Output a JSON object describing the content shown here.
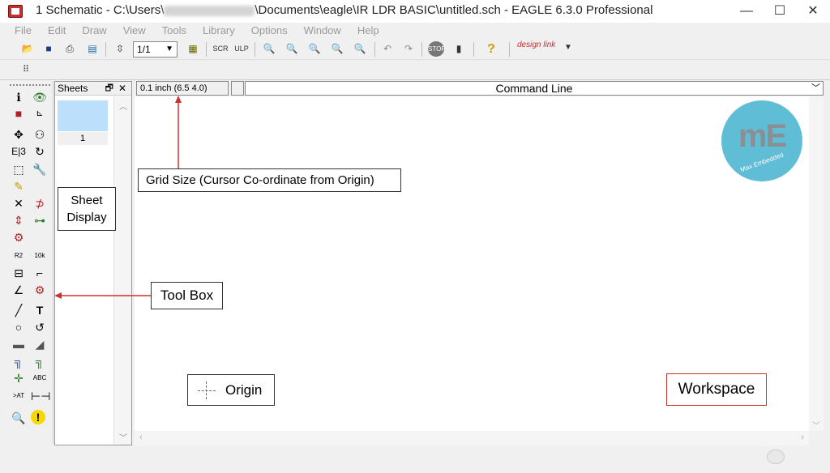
{
  "window": {
    "title_prefix": "1 Schematic - C:\\Users\\",
    "title_suffix": "\\Documents\\eagle\\IR LDR BASIC\\untitled.sch - EAGLE 6.3.0 Professional",
    "minimize": "—",
    "maximize": "☐",
    "close": "✕"
  },
  "menu": [
    "File",
    "Edit",
    "Draw",
    "View",
    "Tools",
    "Library",
    "Options",
    "Window",
    "Help"
  ],
  "toolbar": {
    "zoom_value": "1/1",
    "designlink_label": "design link"
  },
  "sheets_panel": {
    "title": "Sheets",
    "pin": "🗗",
    "close": "✕",
    "sheet_number": "1"
  },
  "coordinate_display": "0.1 inch (6.5 4.0)",
  "command_line": {
    "label": "Command Line"
  },
  "logo": {
    "text": "mE",
    "sub": "Max Embedded"
  },
  "annotations": {
    "grid": "Grid Size (Cursor Co-ordinate from Origin)",
    "sheet_line1": "Sheet",
    "sheet_line2": "Display",
    "toolbox": "Tool Box",
    "origin": "Origin",
    "workspace": "Workspace"
  },
  "colors": {
    "annotation_arrow": "#d0312d",
    "sheet_thumb": "#bcdffc",
    "logo_circle": "#5fbdd6"
  },
  "icons": {
    "toolbar": [
      "open-icon",
      "save-icon",
      "print-icon",
      "cam-icon",
      "board-icon",
      "library-icon",
      "script-icon",
      "ulp-icon",
      "zoom-fit-icon",
      "zoom-in-icon",
      "zoom-out-icon",
      "redraw-icon",
      "zoom-select-icon",
      "undo-icon",
      "redo-icon",
      "stop-icon",
      "go-icon",
      "help-icon"
    ],
    "toolbox": [
      "info-icon",
      "show-icon",
      "display-icon",
      "mark-icon",
      "move-icon",
      "copy-icon",
      "mirror-icon",
      "rotate-icon",
      "group-icon",
      "change-icon",
      "paste-icon",
      "delete-icon",
      "add-icon",
      "pinswap-icon",
      "gateswap-icon",
      "replace-icon",
      "name-icon",
      "value-icon",
      "smash-icon",
      "miter-icon",
      "split-icon",
      "invoke-icon",
      "wire-icon",
      "text-icon",
      "circle-icon",
      "arc-icon",
      "rect-icon",
      "polygon-icon",
      "bus-icon",
      "net-icon",
      "junction-icon",
      "label-icon",
      "attribute-icon",
      "dimension-icon",
      "erc-icon",
      "errors-icon"
    ]
  }
}
